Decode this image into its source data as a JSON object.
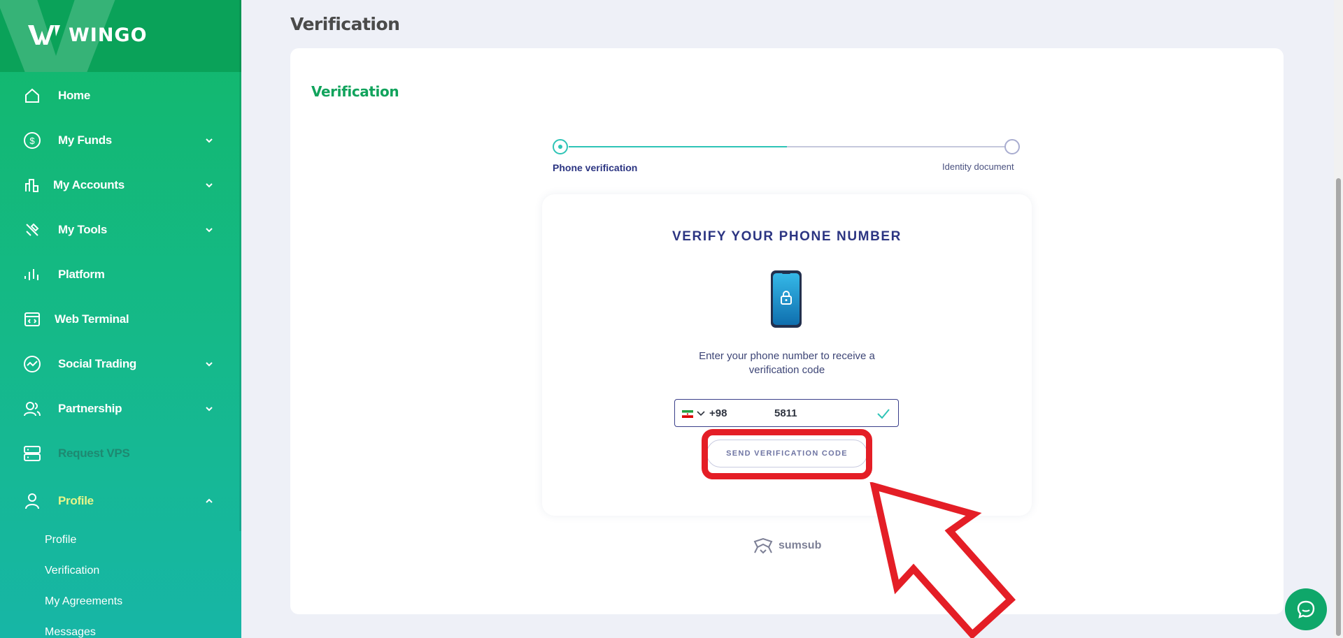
{
  "app": {
    "brand": "WINGO"
  },
  "sidebar": {
    "items": [
      {
        "label": "Home",
        "icon": "home-icon"
      },
      {
        "label": "My Funds",
        "icon": "dollar-circle-icon",
        "expandable": true
      },
      {
        "label": "My Accounts",
        "icon": "bar-chart-icon",
        "expandable": true
      },
      {
        "label": "My Tools",
        "icon": "tools-icon",
        "expandable": true
      },
      {
        "label": "Platform",
        "icon": "platform-icon"
      },
      {
        "label": "Web Terminal",
        "icon": "terminal-icon"
      },
      {
        "label": "Social Trading",
        "icon": "trend-circle-icon",
        "expandable": true
      },
      {
        "label": "Partnership",
        "icon": "users-icon",
        "expandable": true
      },
      {
        "label": "Request VPS",
        "icon": "server-icon",
        "disabled": true
      },
      {
        "label": "Profile",
        "icon": "user-icon",
        "expandable": true,
        "expanded": true
      }
    ],
    "profile_sub": [
      "Profile",
      "Verification",
      "My Agreements",
      "Messages"
    ]
  },
  "main": {
    "page_title": "Verification",
    "card_title": "Verification",
    "stepper": {
      "steps": [
        "Phone verification",
        "Identity document"
      ],
      "active_step": 1,
      "progress_fraction": 0.5
    },
    "verify": {
      "title": "VERIFY YOUR PHONE NUMBER",
      "instruction": "Enter your phone number to receive a verification code",
      "country_code": "+98",
      "phone_value": "5811",
      "send_button": "SEND VERIFICATION CODE"
    },
    "provider": "sumsub"
  },
  "colors": {
    "brand_green": "#12b86a",
    "accent_teal": "#2ec4b6",
    "heading_navy": "#2c3582",
    "annotation_red": "#e41e26"
  }
}
